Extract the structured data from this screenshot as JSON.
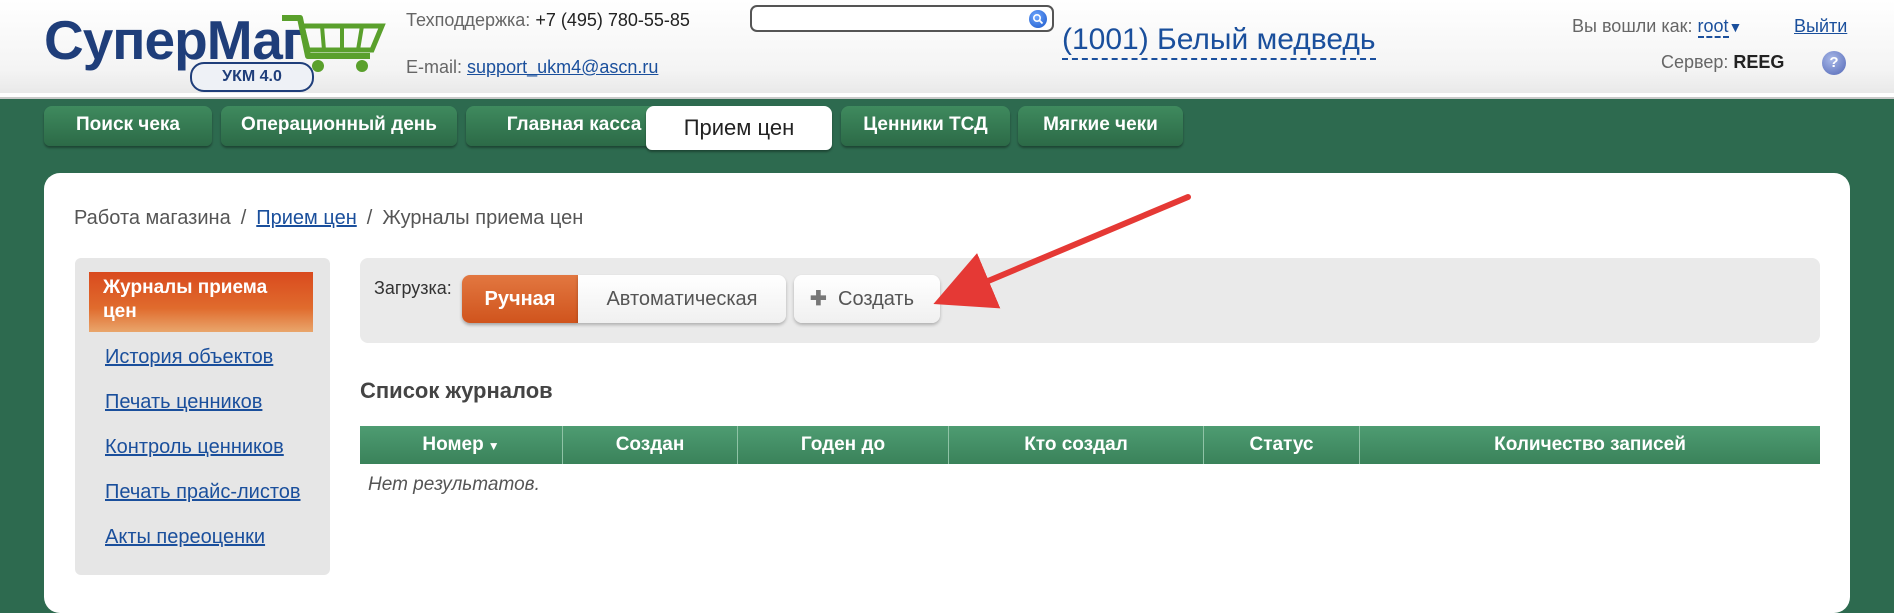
{
  "header": {
    "logo_text": "СуперМаг",
    "logo_badge": "УКМ 4.0",
    "support_label": "Техподдержка:",
    "support_phone": "+7 (495) 780-55-85",
    "email_label": "E-mail:",
    "email_value": "support_ukm4@ascn.ru",
    "search_value": "",
    "store_name": "(1001) Белый медведь",
    "login_label": "Вы вошли как:",
    "login_user": "root",
    "logout_label": "Выйти",
    "server_label": "Сервер:",
    "server_value": "REEG",
    "help_label": "?"
  },
  "tabs": [
    {
      "label": "Поиск чека"
    },
    {
      "label": "Операционный день"
    },
    {
      "label": "Главная касса"
    },
    {
      "label": "Прием цен"
    },
    {
      "label": "Ценники ТСД"
    },
    {
      "label": "Мягкие чеки"
    }
  ],
  "breadcrumb": {
    "root": "Работа магазина",
    "link": "Прием цен",
    "current": "Журналы приема цен"
  },
  "sidebar": {
    "active": "Журналы приема цен",
    "items": [
      {
        "label": "История объектов"
      },
      {
        "label": "Печать ценников"
      },
      {
        "label": "Контроль ценников"
      },
      {
        "label": "Печать прайс-листов"
      },
      {
        "label": "Акты переоценки"
      }
    ]
  },
  "load": {
    "label": "Загрузка:",
    "manual": "Ручная",
    "auto": "Автоматическая",
    "create": "Создать"
  },
  "list": {
    "title": "Список журналов",
    "columns": [
      {
        "label": "Номер"
      },
      {
        "label": "Создан"
      },
      {
        "label": "Годен до"
      },
      {
        "label": "Кто создал"
      },
      {
        "label": "Статус"
      },
      {
        "label": "Количество записей"
      }
    ],
    "empty": "Нет результатов."
  },
  "colors": {
    "brand_green": "#2d6a4f",
    "accent_orange": "#d94a1e",
    "link_blue": "#1a4f9c",
    "annotation_arrow": "#e53935"
  },
  "icons": {
    "search": "search-icon",
    "help": "help-icon",
    "cart": "cart-icon",
    "sort": "sort-down-icon",
    "plus": "plus-icon"
  }
}
